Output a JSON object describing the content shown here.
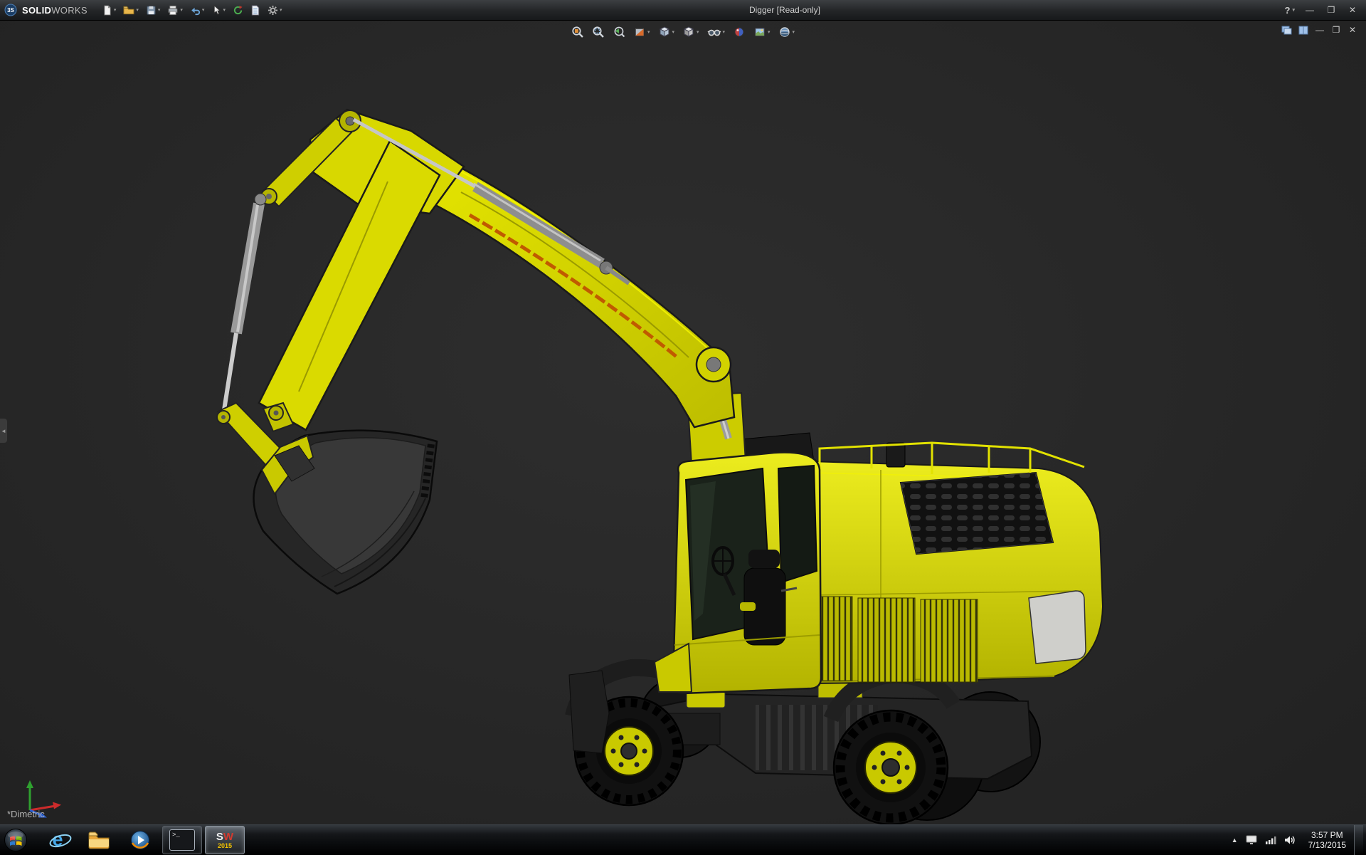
{
  "window": {
    "brand_prefix": "3S",
    "brand_bold": "SOLID",
    "brand_light": "WORKS",
    "title": "Digger [Read-only]",
    "help_label": "?"
  },
  "titlebar_tools": [
    "new",
    "open",
    "save",
    "print",
    "undo",
    "select",
    "rebuild",
    "file-properties",
    "options"
  ],
  "headsup_tools": [
    "zoom-to-fit",
    "zoom-to-area",
    "previous-view",
    "section-view",
    "view-orientation",
    "display-style",
    "hide-show-items",
    "edit-appearance",
    "apply-scene",
    "view-settings"
  ],
  "viewport": {
    "view_label": "*Dimetric",
    "background": "#282828"
  },
  "model": {
    "name": "Digger",
    "body_color": "#d9d900",
    "dark_color": "#1c1c1c",
    "cylinder_color": "#b8b8b8",
    "accent_stripe": "#c05a00"
  },
  "taskbar": {
    "apps": [
      {
        "name": "internet-explorer",
        "letter": "e"
      },
      {
        "name": "file-explorer"
      },
      {
        "name": "media-player"
      },
      {
        "name": "command-prompt",
        "prompt": ">_",
        "running": true
      },
      {
        "name": "solidworks-2015",
        "letter_s": "S",
        "letter_w": "W",
        "year": "2015",
        "active": true
      }
    ],
    "tray": {
      "clock_time": "3:57 PM",
      "clock_date": "7/13/2015"
    }
  }
}
